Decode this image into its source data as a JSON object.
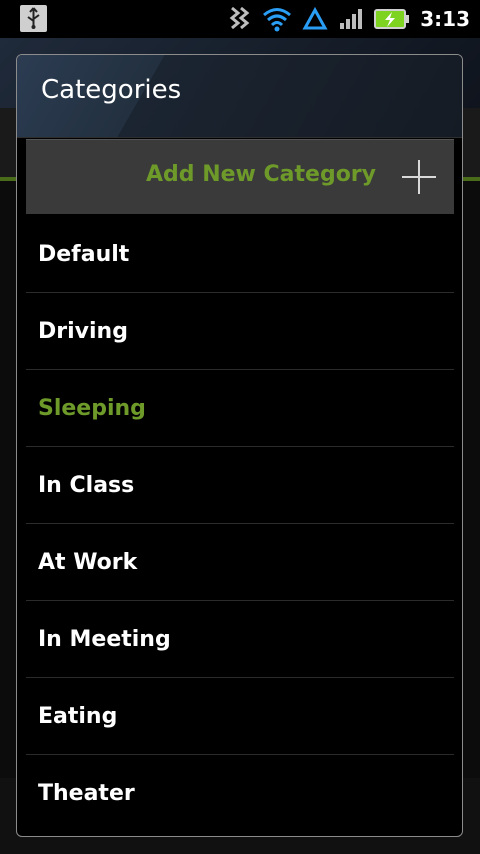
{
  "status_bar": {
    "time": "3:13",
    "icons": [
      "usb-icon",
      "sync-icon",
      "wifi-icon",
      "network-triangle-icon",
      "signal-icon",
      "battery-charging-icon"
    ],
    "colors": {
      "wifi": "#2a9df4",
      "battery": "#7ed321"
    }
  },
  "dialog": {
    "title": "Categories",
    "add_button_label": "Add New Category",
    "selected_color": "#6e9a2a",
    "items": [
      {
        "label": "Default"
      },
      {
        "label": "Driving"
      },
      {
        "label": "Sleeping",
        "selected": true
      },
      {
        "label": "In Class"
      },
      {
        "label": "At Work"
      },
      {
        "label": "In Meeting"
      },
      {
        "label": "Eating"
      },
      {
        "label": "Theater"
      }
    ]
  }
}
